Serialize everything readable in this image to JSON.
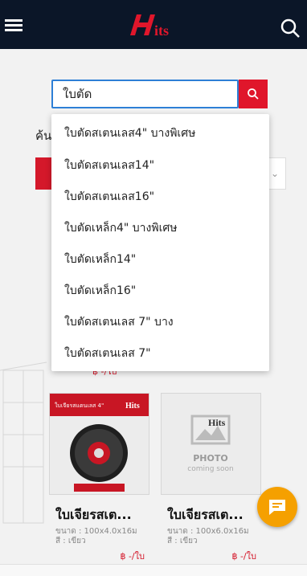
{
  "header": {
    "logo_text": "Hits",
    "menu_icon": "hamburger-menu-icon",
    "search_icon": "search-icon",
    "bg_color": "#0b1628"
  },
  "search": {
    "value": "ใบตัด",
    "button_icon": "search-icon",
    "accent": "#e0162b"
  },
  "suggestions": [
    "ใบตัดสเตนเลส4\" บางพิเศษ",
    "ใบตัดสเตนเลส14\"",
    "ใบตัดสเตนเลส16\"",
    "ใบตัดเหล็ก4\" บางพิเศษ",
    "ใบตัดเหล็ก14\"",
    "ใบตัดเหล็ก16\"",
    "ใบตัดสเตนเลส 7\" บาง",
    "ใบตัดสเตนเลส 7\""
  ],
  "background": {
    "label": "ค้น",
    "price_fragment": "฿ -/ใบ"
  },
  "products": [
    {
      "name": "ใบเจียรสเต...",
      "size": "ขนาด : 100x4.0x16ม",
      "color": "สี : เขียว",
      "price": "฿ -/ใบ",
      "image_label": "ใบเจียรสแตนเลส 4\"",
      "brand": "Hits"
    },
    {
      "name": "ใบเจียรสเต...",
      "size": "ขนาด : 100x6.0x16ม",
      "color": "สี : เขียว",
      "price": "฿ -/ใบ",
      "placeholder_brand": "Hits",
      "placeholder_title": "PHOTO",
      "placeholder_sub": "coming soon"
    }
  ],
  "chat": {
    "icon": "chat-icon",
    "color": "#f5a000"
  }
}
